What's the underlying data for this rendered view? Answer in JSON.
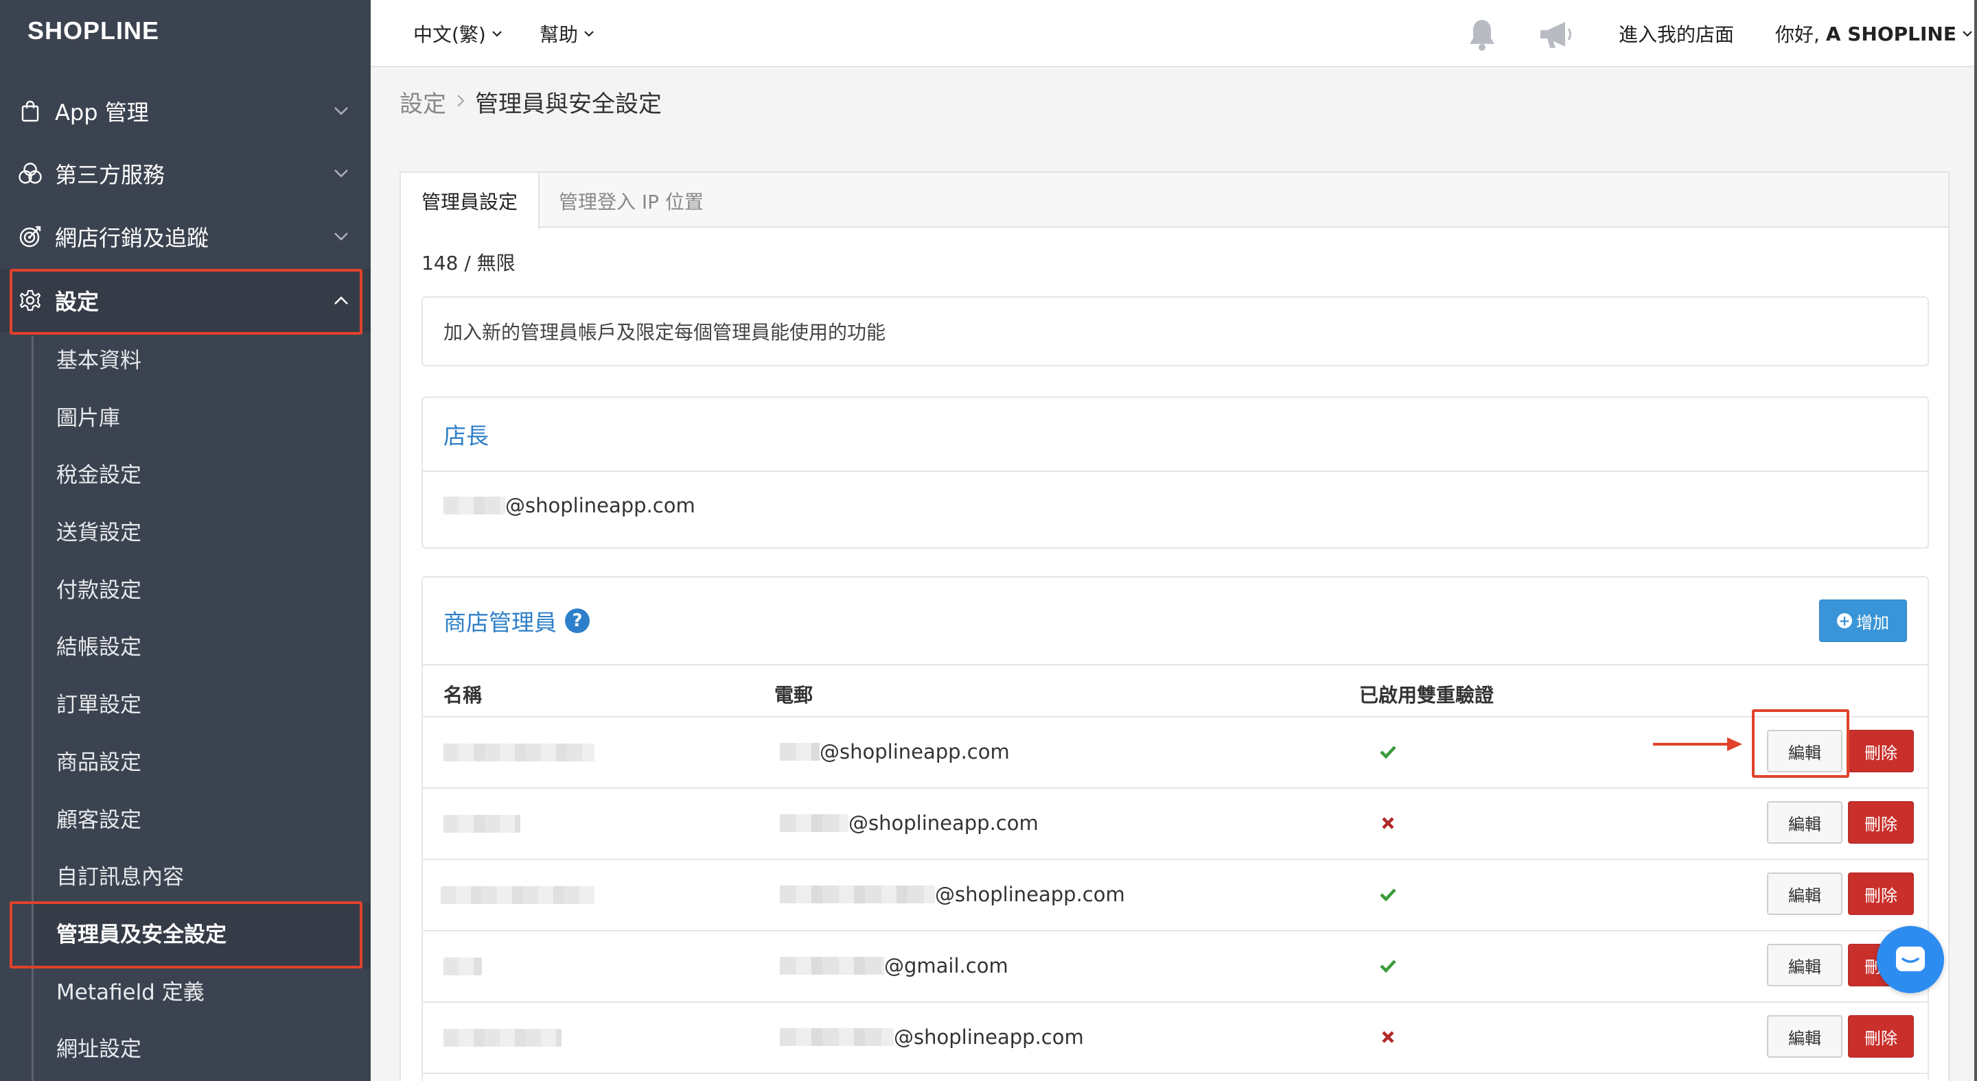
{
  "app": {
    "logo": "SHOPLINE"
  },
  "sidebar": {
    "items": [
      {
        "label": "App 管理",
        "icon": "shopping-bag-icon",
        "expanded": false
      },
      {
        "label": "第三方服務",
        "icon": "circles-icon",
        "expanded": false
      },
      {
        "label": "網店行銷及追蹤",
        "icon": "target-icon",
        "expanded": false
      },
      {
        "label": "設定",
        "icon": "gear-icon",
        "expanded": true
      }
    ],
    "sub_items": [
      {
        "label": "基本資料"
      },
      {
        "label": "圖片庫"
      },
      {
        "label": "稅金設定"
      },
      {
        "label": "送貨設定"
      },
      {
        "label": "付款設定"
      },
      {
        "label": "結帳設定"
      },
      {
        "label": "訂單設定"
      },
      {
        "label": "商品設定"
      },
      {
        "label": "顧客設定"
      },
      {
        "label": "自訂訊息內容"
      },
      {
        "label": "管理員及安全設定",
        "active": true
      },
      {
        "label": "Metafield 定義"
      },
      {
        "label": "網址設定"
      }
    ]
  },
  "topbar": {
    "language": "中文(繁)",
    "help": "幫助",
    "visit_store": "進入我的店面",
    "greeting": "你好, ",
    "user": "A SHOPLINE"
  },
  "breadcrumb": {
    "parent": "設定",
    "current": "管理員與安全設定"
  },
  "tabs": [
    {
      "label": "管理員設定",
      "active": true
    },
    {
      "label": "管理登入 IP 位置",
      "active": false
    }
  ],
  "count": "148 / 無限",
  "description": "加入新的管理員帳戶及限定每個管理員能使用的功能",
  "owner": {
    "title": "店長",
    "email": "@shoplineapp.com"
  },
  "admins": {
    "title": "商店管理員",
    "add_label": "增加",
    "columns": {
      "name": "名稱",
      "email": "電郵",
      "two_factor": "已啟用雙重驗證"
    },
    "edit_label": "編輯",
    "delete_label": "刪除",
    "rows": [
      {
        "email_domain": "@shoplineapp.com",
        "two_factor": true
      },
      {
        "email_domain": "@shoplineapp.com",
        "two_factor": false
      },
      {
        "email_domain": "@shoplineapp.com",
        "two_factor": true
      },
      {
        "email_domain": "@gmail.com",
        "two_factor": true
      },
      {
        "email_domain": "@shoplineapp.com",
        "two_factor": false
      }
    ]
  },
  "colors": {
    "sidebar_bg": "#3c4350",
    "accent_blue": "#2d7fc9",
    "add_button": "#3a95d8",
    "delete_button": "#c9302c",
    "highlight_red": "#e0422b",
    "check_green": "#3a9b3a",
    "cross_red": "#b02a2a"
  }
}
